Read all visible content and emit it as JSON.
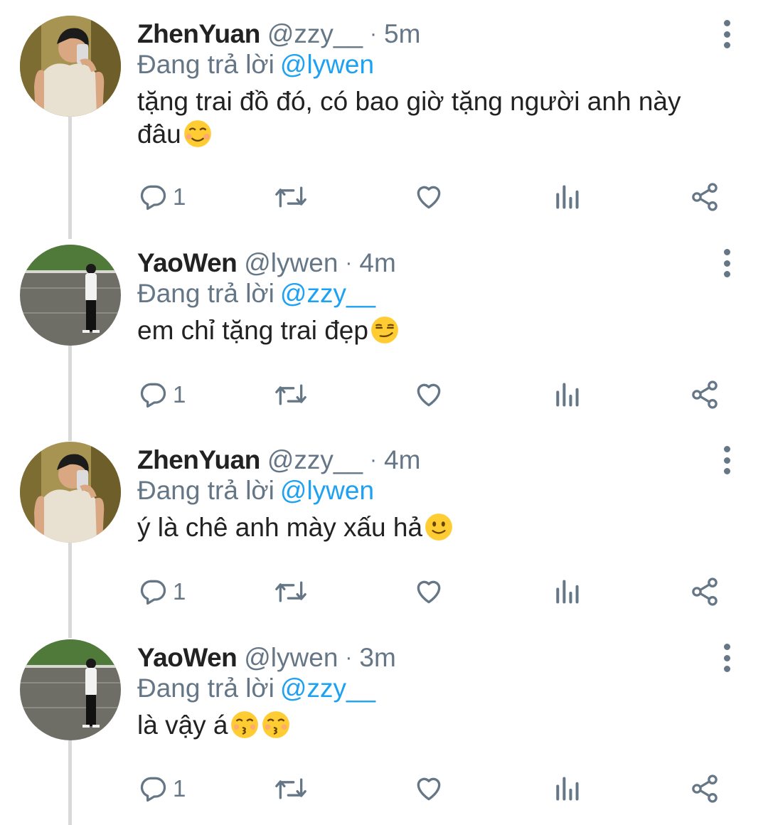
{
  "reply_prefix": "Đang trả lời",
  "tweets": [
    {
      "display_name": "ZhenYuan",
      "handle": "@zzy__",
      "separator": "·",
      "time": "5m",
      "replying_to": "@lywen",
      "text": "tặng trai đồ đó, có bao giờ tặng người anh này đâu",
      "emoji": [
        "smiling-face-with-smiling-eyes"
      ],
      "reply_count": "1",
      "avatar": "zhenyuan-mirror-selfie"
    },
    {
      "display_name": "YaoWen",
      "handle": "@lywen",
      "separator": "·",
      "time": "4m",
      "replying_to": "@zzy__",
      "text": "em chỉ tặng trai đẹp",
      "emoji": [
        "smirking-face"
      ],
      "reply_count": "1",
      "avatar": "yaowen-standing-on-track"
    },
    {
      "display_name": "ZhenYuan",
      "handle": "@zzy__",
      "separator": "·",
      "time": "4m",
      "replying_to": "@lywen",
      "text": "ý là chê anh mày xấu hả",
      "emoji": [
        "slightly-smiling-face"
      ],
      "reply_count": "1",
      "avatar": "zhenyuan-mirror-selfie"
    },
    {
      "display_name": "YaoWen",
      "handle": "@lywen",
      "separator": "·",
      "time": "3m",
      "replying_to": "@zzy__",
      "text": "là vậy á",
      "emoji": [
        "kissing-face-with-closed-eyes",
        "kissing-face-with-closed-eyes"
      ],
      "reply_count": "1",
      "avatar": "yaowen-standing-on-track"
    }
  ],
  "icons": {
    "reply": "reply-icon",
    "retweet": "retweet-icon",
    "like": "heart-icon",
    "analytics": "analytics-icon",
    "share": "share-icon",
    "more": "more-vertical-icon"
  },
  "colors": {
    "secondary_text": "#657786",
    "mention": "#1da1f2",
    "thread_line": "#d9d9d9",
    "emoji_yellow": "#ffcc33"
  }
}
